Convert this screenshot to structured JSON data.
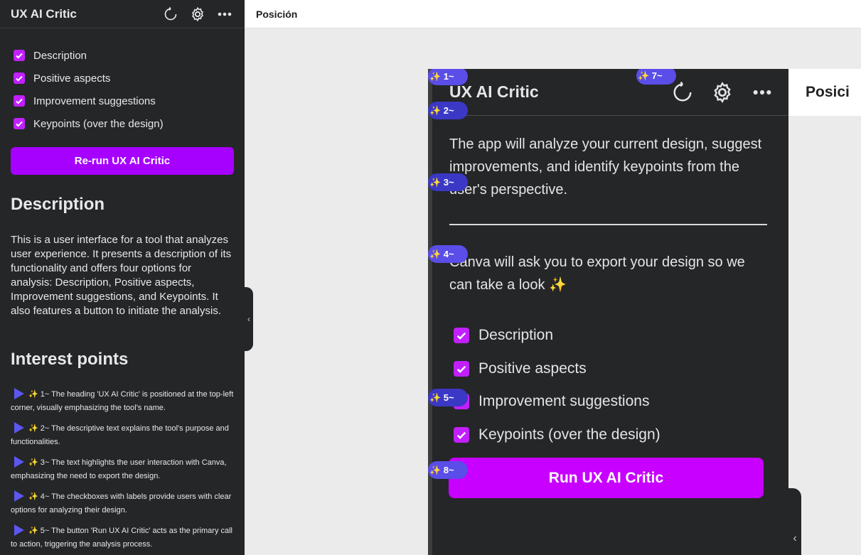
{
  "sidebar": {
    "title": "UX AI Critic",
    "options": [
      {
        "label": "Description",
        "checked": true
      },
      {
        "label": "Positive aspects",
        "checked": true
      },
      {
        "label": "Improvement suggestions",
        "checked": true
      },
      {
        "label": "Keypoints (over the design)",
        "checked": true
      }
    ],
    "rerun_button": "Re-run UX AI Critic",
    "description_heading": "Description",
    "description_text": "This is a user interface for a tool that analyzes user experience. It presents a description of its functionality and offers four options for analysis: Description, Positive aspects, Improvement suggestions, and Keypoints. It also features a button to initiate the analysis.",
    "interest_heading": "Interest points",
    "interest_points": [
      "✨ 1~ The heading 'UX AI Critic' is positioned at the top-left corner, visually emphasizing the tool's name.",
      "✨ 2~ The descriptive text explains the tool's purpose and functionalities.",
      "✨ 3~ The text highlights the user interaction with Canva, emphasizing the need to export the design.",
      "✨ 4~ The checkboxes with labels provide users with clear options for analyzing their design.",
      "✨ 5~ The button 'Run UX AI Critic' acts as the primary call to action, triggering the analysis process."
    ],
    "collapse_glyph": "‹"
  },
  "topbar": {
    "title": "Posición"
  },
  "screenshot": {
    "title": "UX AI Critic",
    "intro": "The app will analyze your current design, suggest improvements, and identify keypoints from the user's perspective.",
    "export_text": "Canva will ask you to export your design so we can take a look ✨",
    "options": [
      "Description",
      "Positive aspects",
      "Improvement suggestions",
      "Keypoints (over the design)"
    ],
    "run_button": "Run UX AI Critic",
    "topbar_title": "Posici",
    "collapse_glyph": "‹"
  },
  "badges": [
    "✨ 1~",
    "✨ 2~",
    "✨ 3~",
    "✨ 4~",
    "✨ 5~",
    "✨ 7~",
    "✨ 8~"
  ],
  "colors": {
    "accent": "#a600ff",
    "checkbox": "#c21fff",
    "badge": "#5a4de8",
    "panel": "#252627"
  },
  "icons": [
    "refresh-icon",
    "gear-icon",
    "more-icon",
    "check-icon",
    "triangle-right-icon"
  ]
}
